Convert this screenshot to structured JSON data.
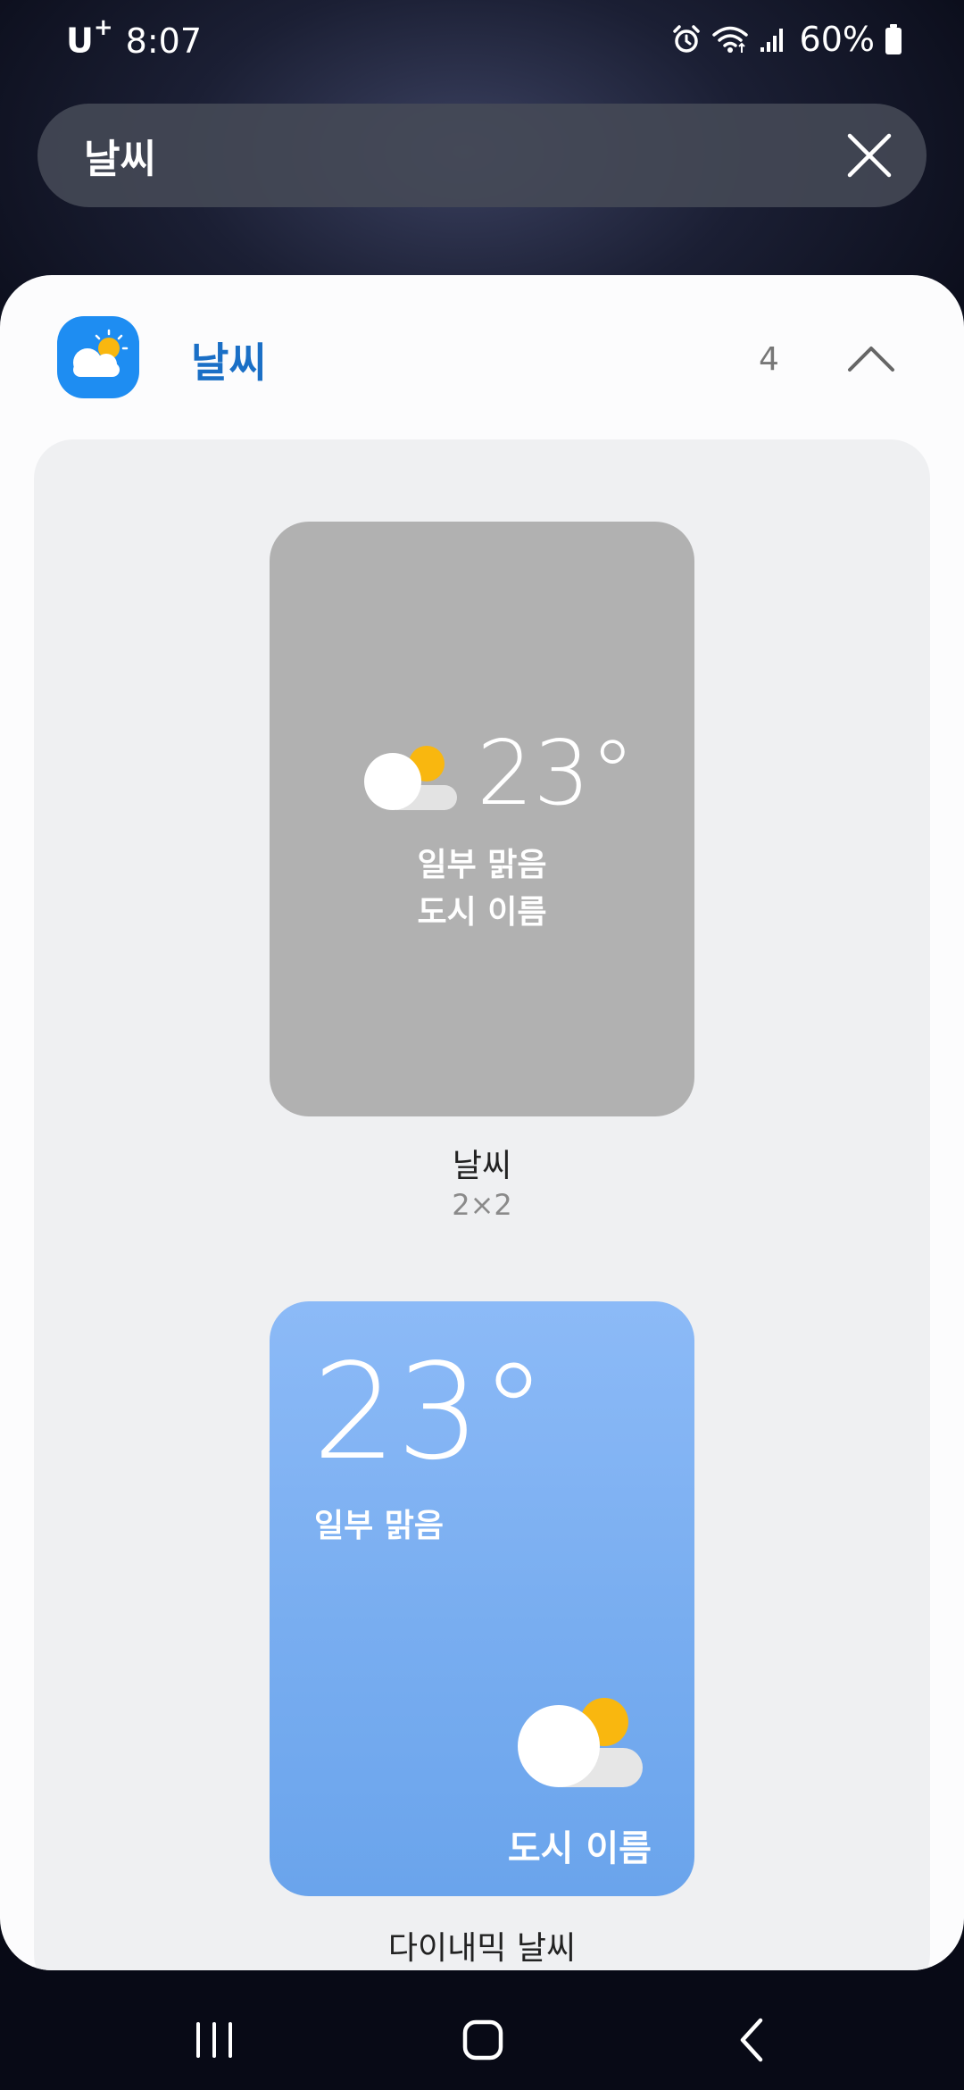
{
  "status_bar": {
    "carrier": "U",
    "carrier_sup": "+",
    "time": "8:07",
    "battery": "60%"
  },
  "search": {
    "query": "날씨"
  },
  "app_section": {
    "name": "날씨",
    "count": "4"
  },
  "widgets": [
    {
      "temp": "23°",
      "condition": "일부 맑음",
      "city": "도시 이름",
      "label": "날씨",
      "size": "2×2"
    },
    {
      "temp": "23°",
      "condition": "일부 맑음",
      "city": "도시 이름",
      "label": "다이내믹 날씨"
    }
  ],
  "icons": {
    "alarm": "alarm-icon",
    "wifi": "wifi-icon",
    "signal": "signal-icon",
    "battery": "battery-icon",
    "clear": "close-icon",
    "app": "weather-app-icon",
    "collapse": "chevron-up-icon",
    "nav_recent": "recent-apps-icon",
    "nav_home": "home-icon",
    "nav_back": "back-icon"
  },
  "colors": {
    "accent": "#1a6fc6",
    "sun": "#f9b70f",
    "gray_widget": "#b1b1b1",
    "blue_widget": "#78adf0"
  }
}
